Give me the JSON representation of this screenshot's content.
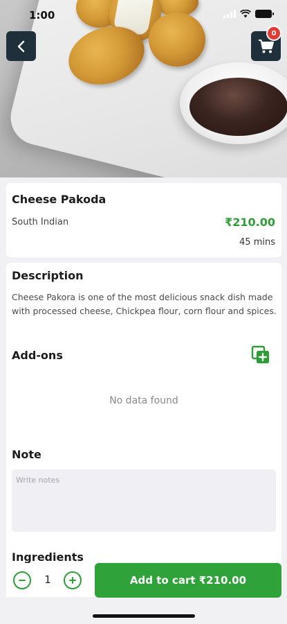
{
  "status_bar": {
    "time": "1:00"
  },
  "header": {
    "cart_count": "0"
  },
  "item": {
    "name": "Cheese Pakoda",
    "category": "South Indian",
    "price": "₹210.00",
    "prep_time": "45 mins"
  },
  "description": {
    "title": "Description",
    "text": "Cheese Pakora is one of the most delicious snack dish made with processed cheese, Chickpea flour, corn flour and spices."
  },
  "addons": {
    "title": "Add-ons",
    "empty_text": "No data found"
  },
  "note": {
    "title": "Note",
    "placeholder": "Write notes",
    "value": ""
  },
  "ingredients": {
    "title": "Ingredients"
  },
  "cart_bar": {
    "quantity": "1",
    "add_label": "Add to cart ₹210.00"
  },
  "colors": {
    "accent": "#2fa23a",
    "button_dark": "#20303a",
    "badge": "#e53935"
  }
}
